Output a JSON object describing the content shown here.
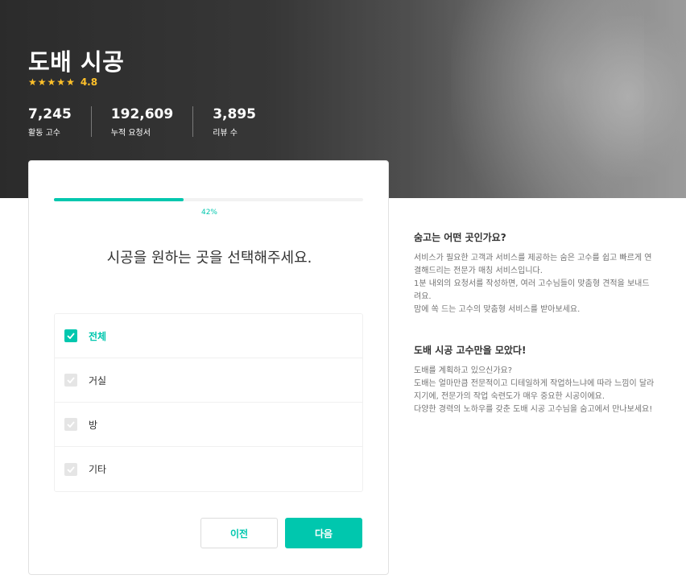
{
  "hero": {
    "title": "도배 시공",
    "rating": "4.8",
    "stats": [
      {
        "value": "7,245",
        "label": "활동 고수"
      },
      {
        "value": "192,609",
        "label": "누적 요청서"
      },
      {
        "value": "3,895",
        "label": "리뷰 수"
      }
    ]
  },
  "form": {
    "progress": 0.42,
    "progress_label": "42%",
    "question": "시공을 원하는 곳을 선택해주세요.",
    "options": [
      {
        "label": "전체",
        "checked": true
      },
      {
        "label": "거실",
        "checked": false
      },
      {
        "label": "방",
        "checked": false
      },
      {
        "label": "기타",
        "checked": false
      }
    ],
    "prev_label": "이전",
    "next_label": "다음"
  },
  "info": {
    "section1": {
      "title": "숨고는 어떤 곳인가요?",
      "body": "서비스가 필요한 고객과 서비스를 제공하는 숨은 고수를 쉽고 빠르게 연결해드리는 전문가 매칭 서비스입니다.\n1분 내외의 요청서를 작성하면, 여러 고수님들이 맞춤형 견적을 보내드려요.\n맘에 쏙 드는 고수의 맞춤형 서비스를 받아보세요."
    },
    "section2": {
      "title": "도배 시공 고수만을 모았다!",
      "body": "도배를 계획하고 있으신가요?\n도배는 얼마만큼 전문적이고 디테일하게 작업하느냐에 따라 느낌이 달라지기에, 전문가의 작업 숙련도가 매우 중요한 시공이에요.\n다양한 경력의 노하우를 갖춘 도배 시공 고수님을 숨고에서 만나보세요!"
    }
  },
  "colors": {
    "accent": "#00c7ae",
    "star": "#ffc12a"
  },
  "icons": {
    "star": "star-icon",
    "check": "check-icon"
  }
}
